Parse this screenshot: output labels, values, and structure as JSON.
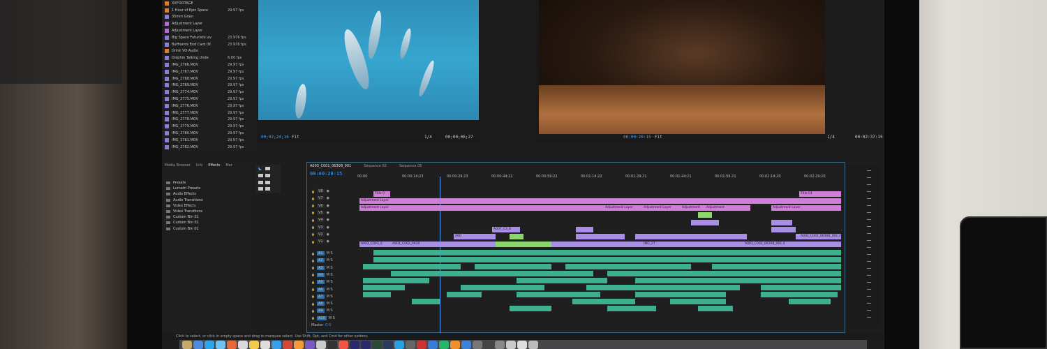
{
  "project": {
    "items": [
      {
        "name": "XXFOOTAGE",
        "fps": "",
        "color": "#e07b2a"
      },
      {
        "name": "1 Hour of Epic Space",
        "fps": "29.97 fps",
        "color": "#e07b2a"
      },
      {
        "name": "35mm Grain",
        "fps": "",
        "color": "#8a7cd9"
      },
      {
        "name": "Adjustment Layer",
        "fps": "",
        "color": "#b06cd1"
      },
      {
        "name": "Adjustment Layer",
        "fps": "",
        "color": "#b06cd1"
      },
      {
        "name": "Big Space Futuristic.av",
        "fps": "23.976 fps",
        "color": "#8a7cd9"
      },
      {
        "name": "Buffnerds End Card (N",
        "fps": "23.976 fps",
        "color": "#8a7cd9"
      },
      {
        "name": "Drink VO Audio",
        "fps": "",
        "color": "#e07b2a"
      },
      {
        "name": "Dolphin Talking Unde",
        "fps": "6.00 fps",
        "color": "#8a7cd9"
      },
      {
        "name": "IMG_2766.MOV",
        "fps": "29.97 fps",
        "color": "#8a7cd9"
      },
      {
        "name": "IMG_2767.MOV",
        "fps": "29.97 fps",
        "color": "#8a7cd9"
      },
      {
        "name": "IMG_2768.MOV",
        "fps": "29.97 fps",
        "color": "#8a7cd9"
      },
      {
        "name": "IMG_2769.MOV",
        "fps": "29.97 fps",
        "color": "#8a7cd9"
      },
      {
        "name": "IMG_2774.MOV",
        "fps": "29.97 fps",
        "color": "#8a7cd9"
      },
      {
        "name": "IMG_2775.MOV",
        "fps": "29.97 fps",
        "color": "#8a7cd9"
      },
      {
        "name": "IMG_2776.MOV",
        "fps": "29.97 fps",
        "color": "#8a7cd9"
      },
      {
        "name": "IMG_2777.MOV",
        "fps": "29.97 fps",
        "color": "#8a7cd9"
      },
      {
        "name": "IMG_2778.MOV",
        "fps": "29.97 fps",
        "color": "#8a7cd9"
      },
      {
        "name": "IMG_2779.MOV",
        "fps": "29.97 fps",
        "color": "#8a7cd9"
      },
      {
        "name": "IMG_2780.MOV",
        "fps": "29.97 fps",
        "color": "#8a7cd9"
      },
      {
        "name": "IMG_2781.MOV",
        "fps": "29.97 fps",
        "color": "#8a7cd9"
      },
      {
        "name": "IMG_2782.MOV",
        "fps": "29.97 fps",
        "color": "#8a7cd9"
      }
    ]
  },
  "source_monitor": {
    "timecode_left": "00;02;24;16",
    "fit": "Fit",
    "scale": "1/4",
    "timecode_right": "00;00;06;27"
  },
  "program_monitor": {
    "timecode_left": "00:00:28:15",
    "fit": "Fit",
    "scale": "1/4",
    "timecode_right": "00:02:37:15"
  },
  "effects_panel": {
    "tabs": [
      "Media Browser",
      "Info",
      "Effects",
      "Mar"
    ],
    "active_tab": "Effects",
    "items": [
      "Presets",
      "Lumetri Presets",
      "Audio Effects",
      "Audio Transitions",
      "Video Effects",
      "Video Transitions",
      "Custom Bin 01",
      "Custom Bin 01",
      "Custom Bin 01"
    ]
  },
  "timeline": {
    "tabs": [
      "A003_C001_0630B_001",
      "Sequence 02",
      "Sequence 05"
    ],
    "active_tab": "A003_C001_0630B_001",
    "timecode": "00:00:28:15",
    "ruler": [
      "00:00",
      "00:00:14:23",
      "00:00:29:23",
      "00:00:44:22",
      "00:00:59:22",
      "00:01:14:22",
      "00:01:29:21",
      "00:01:44:21",
      "00:01:59:21",
      "00:02:14:20",
      "00:02:29:20"
    ],
    "video_tracks": [
      "V8",
      "V7",
      "V6",
      "V5",
      "V4",
      "V3",
      "V2",
      "V1"
    ],
    "audio_tracks": [
      "A1",
      "A2",
      "A3",
      "A4",
      "A5",
      "A6",
      "A7",
      "A8",
      "A9",
      "A10"
    ],
    "master_label": "Master",
    "master_value": "0.0",
    "clip_labels": {
      "title_a": "Title 0",
      "title_b": "Title 01",
      "adj_1": "Adjustment Layer",
      "adj_2": "Adjustment Layer",
      "adj_3": "Adjustment Layer",
      "adj_4": "Adjustment Layer",
      "adj_5": "Adjustment",
      "adj_6": "Adjustment",
      "adj_7": "Adjustment Layer",
      "v2_a": "A007_C3_8",
      "v2_b": "A00",
      "v1_a": "A003_C003_0",
      "v1_b": "A003_C002_0630",
      "v1_c": "A003_C001_0630B_001.4",
      "v1_d": "A003_C002_0630B_001.4",
      "v1_e": "IMG_27"
    }
  },
  "status_bar": "Click to select, or click in empty space and drag to marquee select. Use Shift, Opt, and Cmd for other options.",
  "colors": {
    "video_clip": "#a88ee6",
    "adjustment": "#cf7fd8",
    "audio_clip": "#3fb08f",
    "green_clip": "#8ad86a",
    "accent": "#3aa0ff"
  }
}
